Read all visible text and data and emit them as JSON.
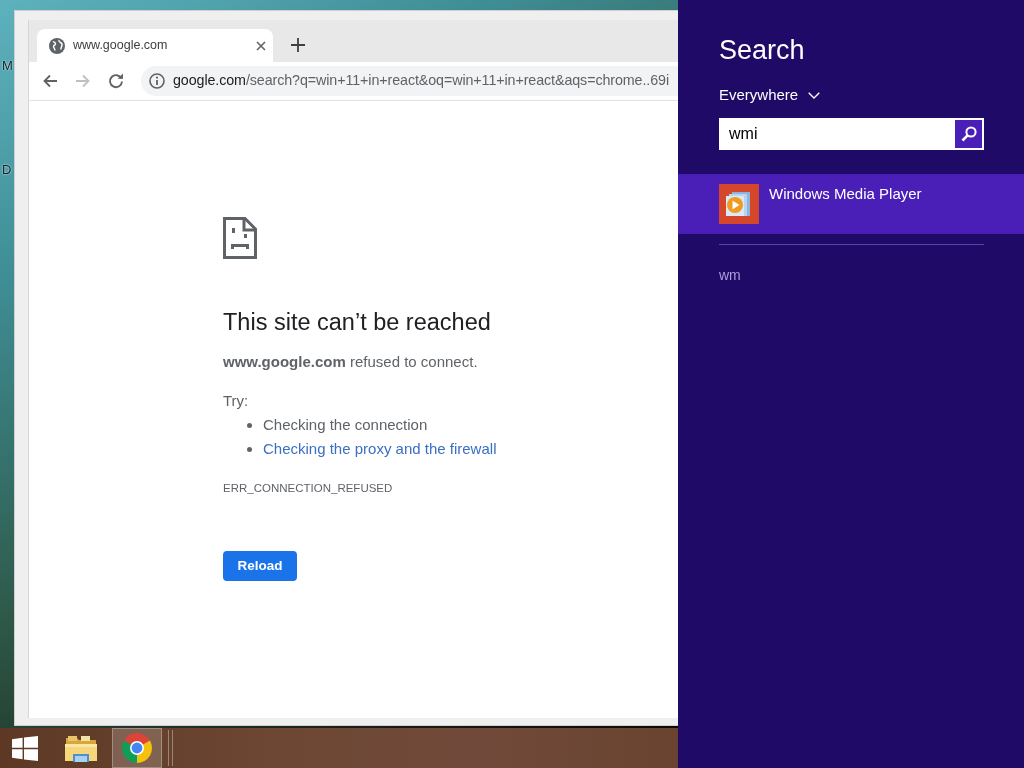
{
  "desktop": {
    "icon_labels": [
      "M",
      "D"
    ]
  },
  "browser": {
    "tabs": [
      {
        "title": "www.google.com",
        "selected": true
      }
    ],
    "nav_buttons": [
      {
        "kind": "back",
        "disabled": false
      },
      {
        "kind": "forward",
        "disabled": true
      },
      {
        "kind": "reload",
        "disabled": false
      }
    ],
    "url": "google.com/search?q=win+11+in+react&oq=win+11+in+react&aqs=chrome..69i",
    "page": {
      "title": "This site can’t be reached",
      "message": "**www.google.com** refused to connect.",
      "try_label": "Try:",
      "suggestions": [
        {
          "kind": "text",
          "text": "Checking the connection"
        },
        {
          "kind": "link",
          "text": "Checking the proxy and the firewall"
        }
      ],
      "error_code": "ERR_CONNECTION_REFUSED",
      "button": "Reload"
    }
  },
  "taskbar": {
    "apps": [
      {
        "kind": "folder",
        "active": false
      },
      {
        "kind": "browser",
        "active": true
      }
    ]
  },
  "charm": {
    "title": "Search",
    "scope": "Everywhere",
    "query": "wmi",
    "results": [
      {
        "title": "Windows Media Player",
        "selected": true
      }
    ],
    "suggestions": [
      "wm"
    ]
  }
}
